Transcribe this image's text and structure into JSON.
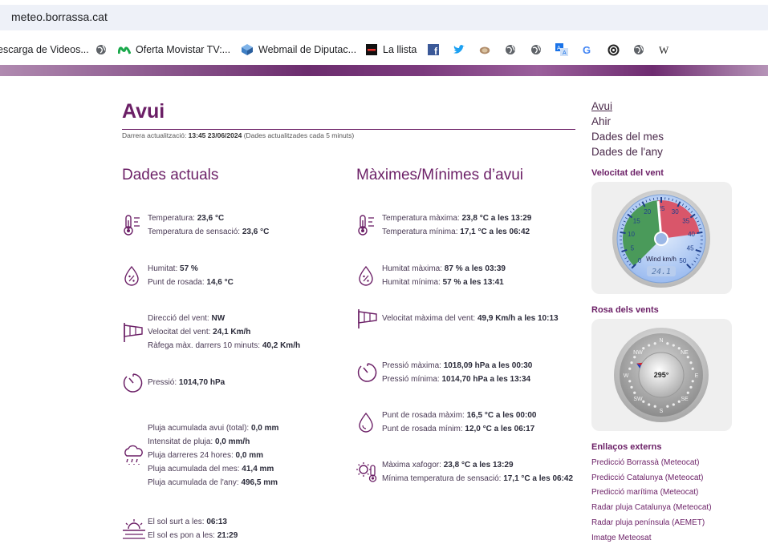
{
  "browser": {
    "url": "meteo.borrassa.cat",
    "bookmarks": [
      {
        "label": "escarga de Videos...",
        "icon": "none"
      },
      {
        "label": "",
        "icon": "globe-icon"
      },
      {
        "label": "Oferta Movistar TV:...",
        "icon": "movistar-icon"
      },
      {
        "label": "Webmail de Diputac...",
        "icon": "cube-icon"
      },
      {
        "label": "La llista",
        "icon": "llista-icon"
      },
      {
        "label": "",
        "icon": "facebook-icon"
      },
      {
        "label": "",
        "icon": "twitter-icon"
      },
      {
        "label": "",
        "icon": "animal-icon"
      },
      {
        "label": "",
        "icon": "globe-icon"
      },
      {
        "label": "",
        "icon": "globe-icon"
      },
      {
        "label": "",
        "icon": "translate-icon"
      },
      {
        "label": "",
        "icon": "google-icon"
      },
      {
        "label": "",
        "icon": "spiral-icon"
      },
      {
        "label": "",
        "icon": "globe-icon"
      },
      {
        "label": "",
        "icon": "wikipedia-icon"
      }
    ]
  },
  "page": {
    "title": "Avui",
    "update": {
      "prefix": "Darrera actualització: ",
      "time": "13:45 23/06/2024",
      "suffix": " (Dades actualitzades cada 5 minuts)"
    },
    "current": {
      "heading": "Dades actuals",
      "temp": [
        [
          "Temperatura: ",
          "23,6 °C"
        ],
        [
          "Temperatura de sensació: ",
          "23,6 °C"
        ]
      ],
      "humidity": [
        [
          "Humitat: ",
          "57 %"
        ],
        [
          "Punt de rosada: ",
          "14,6 °C"
        ]
      ],
      "wind": [
        [
          "Direcció del vent: ",
          "NW"
        ],
        [
          "Velocitat del vent: ",
          "24,1 Km/h"
        ],
        [
          "Ràfega màx. darrers 10 minuts: ",
          "40,2 Km/h"
        ]
      ],
      "pressure": [
        [
          "Pressió: ",
          "1014,70 hPa"
        ]
      ],
      "rain": [
        [
          "Pluja acumulada avui (total): ",
          "0,0 mm"
        ],
        [
          "Intensitat de pluja: ",
          "0,0 mm/h"
        ],
        [
          "Pluja darreres 24 hores: ",
          "0,0 mm"
        ],
        [
          "Pluja acumulada del mes: ",
          "41,4 mm"
        ],
        [
          "Pluja acumulada de l'any: ",
          "496,5 mm"
        ]
      ],
      "sun": [
        [
          "El sol surt a les: ",
          "06:13"
        ],
        [
          "El sol es pon a les: ",
          "21:29"
        ]
      ]
    },
    "maxmin": {
      "heading": "Màximes/Mínimes d’avui",
      "temp": [
        [
          "Temperatura màxima: ",
          "23,8 °C a les 13:29"
        ],
        [
          "Temperatura mínima: ",
          "17,1 °C a les 06:42"
        ]
      ],
      "humidity": [
        [
          "Humitat màxima: ",
          "87 % a les 03:39"
        ],
        [
          "Humitat mínima: ",
          "57 % a les 13:41"
        ]
      ],
      "wind": [
        [
          "Velocitat màxima del vent: ",
          "49,9 Km/h a les 10:13"
        ]
      ],
      "pressure": [
        [
          "Pressió màxima: ",
          "1018,09 hPa a les 00:30"
        ],
        [
          "Pressió mínima: ",
          "1014,70 hPa a les 13:34"
        ]
      ],
      "dew": [
        [
          "Punt de rosada màxim: ",
          "16,5 °C a les 00:00"
        ],
        [
          "Punt de rosada mínim: ",
          "12,0 °C a les 06:17"
        ]
      ],
      "heat": [
        [
          "Màxima xafogor: ",
          "23,8 °C a les 13:29"
        ],
        [
          "Mínima temperatura de sensació: ",
          "17,1 °C a les 06:42"
        ]
      ]
    },
    "nav": [
      "Avui",
      "Ahir",
      "Dades del mes",
      "Dades de l'any"
    ],
    "wind_speed": {
      "heading": "Velocitat del vent",
      "unit_label": "Wind km/h",
      "value": 24.1,
      "display": "24.1",
      "ticks": [
        "0",
        "5",
        "10",
        "15",
        "20",
        "25",
        "30",
        "35",
        "40",
        "45",
        "50"
      ]
    },
    "wind_rose": {
      "heading": "Rosa dels vents",
      "display": "295°",
      "direction_deg": 295,
      "labels": [
        "N",
        "NE",
        "E",
        "SE",
        "S",
        "SW",
        "W",
        "NW"
      ]
    },
    "links": {
      "heading": "Enllaços externs",
      "items": [
        "Predicció Borrassà (Meteocat)",
        "Predicció Catalunya (Meteocat)",
        "Predicció marítima (Meteocat)",
        "Radar pluja Catalunya (Meteocat)",
        "Radar pluja península (AEMET)",
        "Imatge Meteosat"
      ]
    },
    "colors": {
      "accent": "#6b1f66",
      "gauge_green": "#4a9a5a",
      "gauge_red": "#d9566a",
      "gauge_blue": "#6f9ee0"
    }
  }
}
